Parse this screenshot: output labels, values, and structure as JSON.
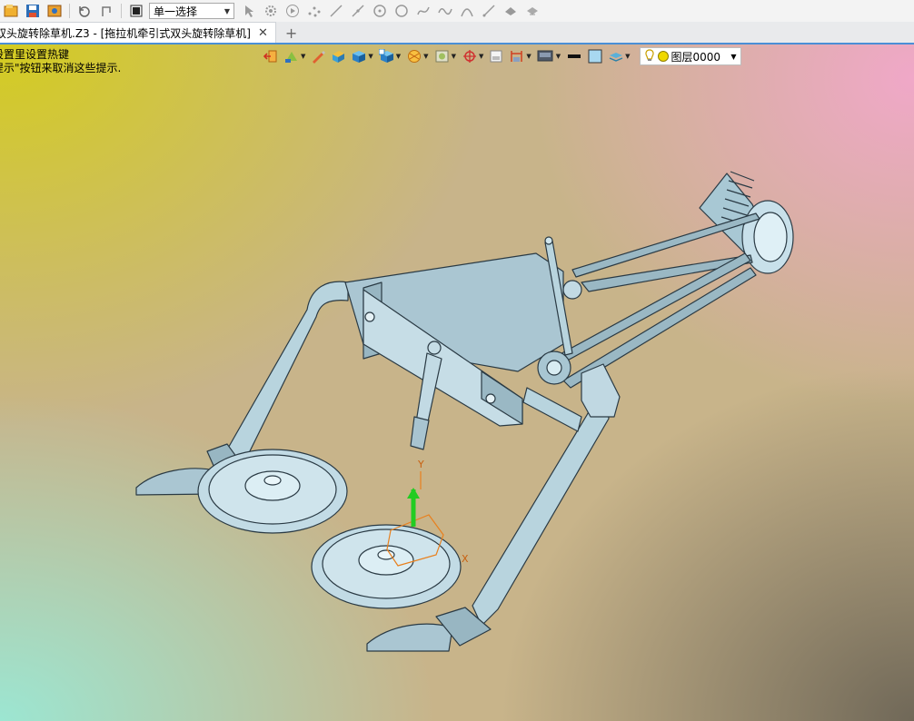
{
  "toolbar": {
    "select_mode": "单一选择",
    "icons": [
      "open-icon",
      "save-icon",
      "image-icon",
      "undo-icon",
      "redo-icon",
      "stop-icon",
      "pointer-icon",
      "gear-icon",
      "play-icon",
      "points-icon",
      "line-icon",
      "line2-icon",
      "circle-dot-icon",
      "circle-icon",
      "spline-icon",
      "curve-icon",
      "arc-icon",
      "line3-icon",
      "hat-icon",
      "hat2-icon"
    ]
  },
  "tab": {
    "title": "双头旋转除草机.Z3 - [拖拉机牵引式双头旋转除草机]",
    "close": "✕",
    "new": "+"
  },
  "viewport": {
    "hint_line1": "设置里设置热键",
    "hint_line2": "提示\"按钮来取消这些提示."
  },
  "view_toolbar": {
    "layer": "图层0000",
    "icons": [
      "exit-icon",
      "tree-icon",
      "pen-icon",
      "face-icon",
      "cube-icon",
      "cube-view-icon",
      "render-icon",
      "frame-icon",
      "target-icon",
      "panel-icon",
      "dimension-icon",
      "display-icon",
      "line-width-icon",
      "color-icon",
      "layers-icon",
      "bulb-icon"
    ]
  },
  "triad": {
    "y_label": "Y",
    "x_label": "X"
  },
  "colors": {
    "accent": "#4a8fd6",
    "model": "#b8d4de",
    "model_edge": "#2a3a44",
    "axis_y": "#22cc22"
  }
}
